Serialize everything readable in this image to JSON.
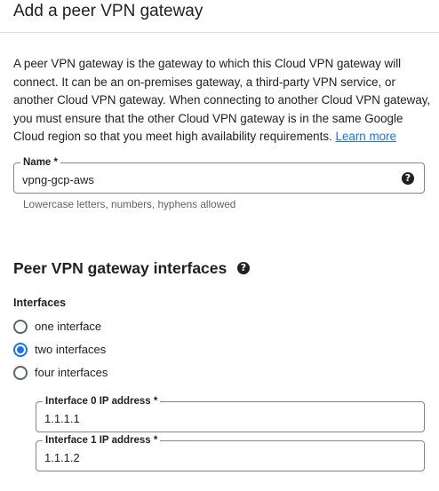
{
  "header": {
    "title": "Add a peer VPN gateway"
  },
  "description": {
    "text": "A peer VPN gateway is the gateway to which this Cloud VPN gateway will connect. It can be an on-premises gateway, a third-party VPN service, or another Cloud VPN gateway. When connecting to another Cloud VPN gateway, you must ensure that the other Cloud VPN gateway is in the same Google Cloud region so that you meet high availability requirements. ",
    "link": "Learn more"
  },
  "name_field": {
    "label": "Name *",
    "value": "vpng-gcp-aws",
    "hint": "Lowercase letters, numbers, hyphens allowed",
    "help_icon": "help-circle-icon"
  },
  "interfaces_section": {
    "title": "Peer VPN gateway interfaces",
    "help_icon": "help-circle-icon",
    "group_label": "Interfaces",
    "options": [
      {
        "label": "one interface",
        "selected": false
      },
      {
        "label": "two interfaces",
        "selected": true
      },
      {
        "label": "four interfaces",
        "selected": false
      }
    ],
    "fields": [
      {
        "label": "Interface 0 IP address *",
        "value": "1.1.1.1"
      },
      {
        "label": "Interface 1 IP address *",
        "value": "1.1.1.2"
      }
    ]
  },
  "colors": {
    "accent": "#1a73e8",
    "text": "#202124",
    "secondary_text": "#5f6368",
    "border": "#80868b"
  }
}
